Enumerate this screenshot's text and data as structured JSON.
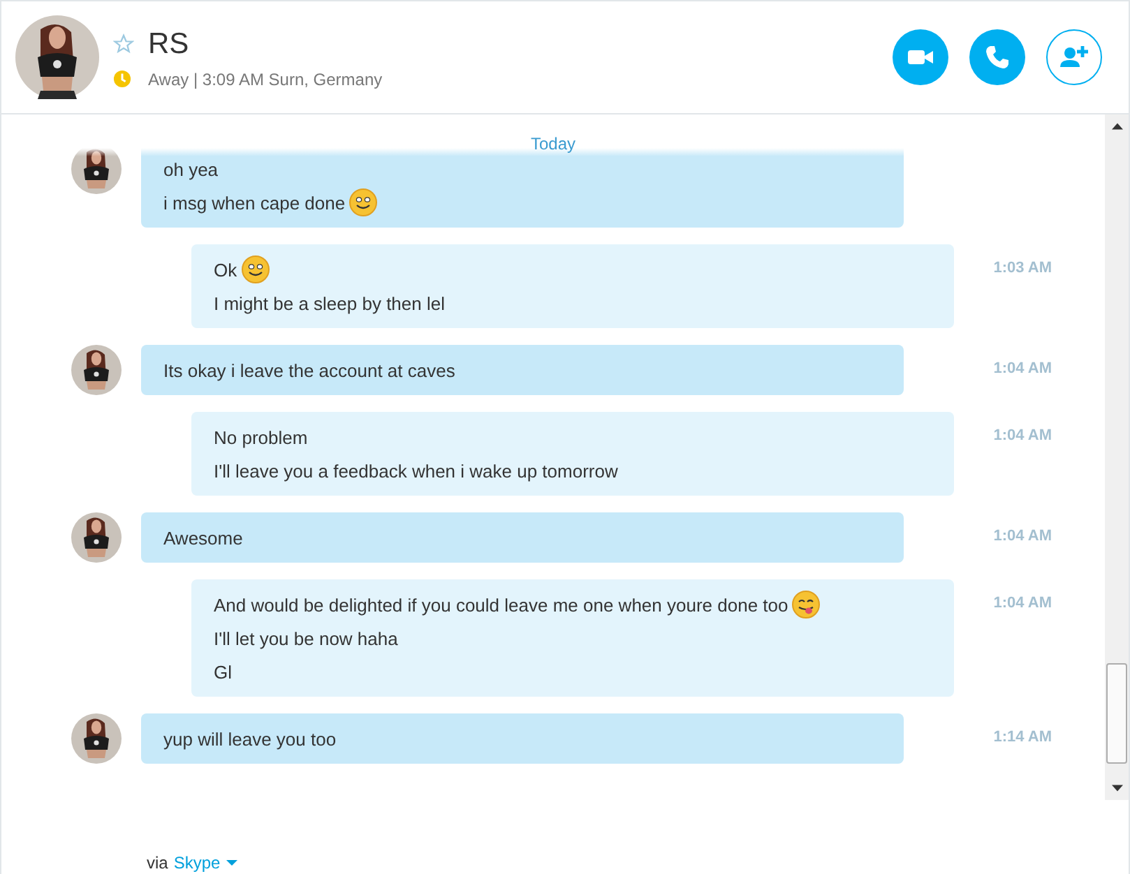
{
  "contact": {
    "name": "RS",
    "favorite": false,
    "status_line": "Away | 3:09 AM Surn, Germany"
  },
  "header_buttons": [
    {
      "kind": "video"
    },
    {
      "kind": "call"
    },
    {
      "kind": "add_contact"
    }
  ],
  "date_divider": "Today",
  "messages": [
    {
      "kind": "incoming",
      "lines": [
        {
          "kind": "plain",
          "text": "oh yea"
        },
        {
          "kind": "smile",
          "text": "i msg when cape done"
        }
      ]
    },
    {
      "kind": "outgoing",
      "time": "1:03 AM",
      "lines": [
        {
          "kind": "smile",
          "text": "Ok"
        },
        {
          "kind": "plain",
          "text": "I might be a sleep by then lel"
        }
      ]
    },
    {
      "kind": "incoming",
      "time": "1:04 AM",
      "lines": [
        {
          "kind": "plain",
          "text": "Its okay i leave the account at caves"
        }
      ]
    },
    {
      "kind": "outgoing",
      "time": "1:04 AM",
      "lines": [
        {
          "kind": "plain",
          "text": "No problem"
        },
        {
          "kind": "plain",
          "text": "I'll leave you a feedback when i wake up tomorrow"
        }
      ]
    },
    {
      "kind": "incoming",
      "time": "1:04 AM",
      "lines": [
        {
          "kind": "plain",
          "text": "Awesome"
        }
      ]
    },
    {
      "kind": "outgoing",
      "time": "1:04 AM",
      "lines": [
        {
          "kind": "tongue",
          "text": "And would be delighted if you could leave me one when youre done too"
        },
        {
          "kind": "plain",
          "text": "I'll let you be now haha"
        },
        {
          "kind": "plain",
          "text": "Gl"
        }
      ]
    },
    {
      "kind": "incoming",
      "time": "1:14 AM",
      "lines": [
        {
          "kind": "plain",
          "text": "yup will leave you too"
        }
      ]
    }
  ],
  "footer": {
    "via": "via",
    "network": "Skype"
  }
}
